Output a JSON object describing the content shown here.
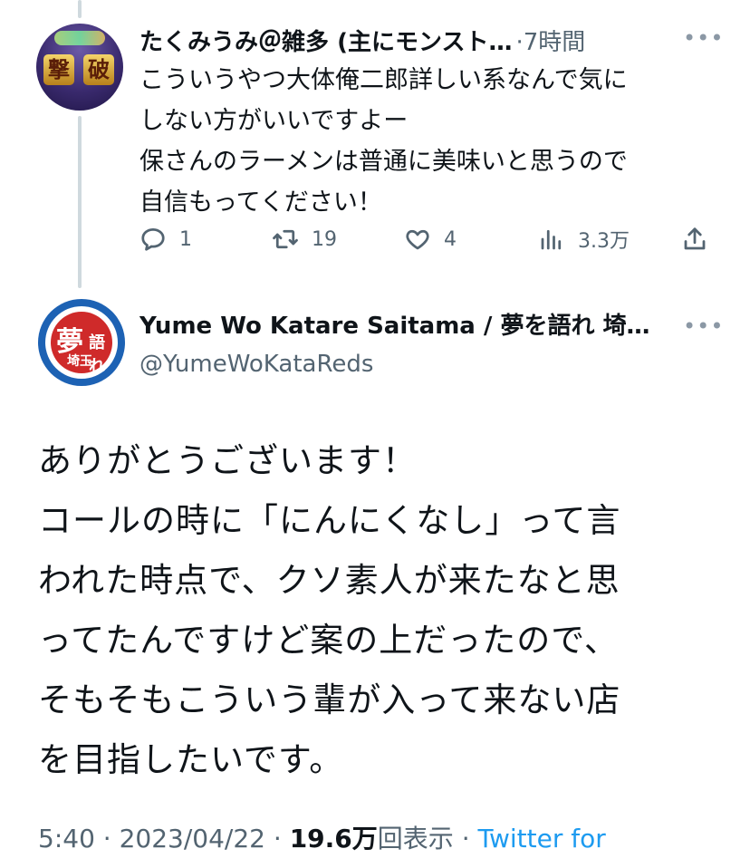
{
  "reply": {
    "author_name": "たくみうみ＠雑多 (主にモンスト…",
    "time": "·7時間",
    "lines": [
      "こういうやつ大体俺二郎詳しい系なんで気に",
      "しない方がいいですよー",
      "保さんのラーメンは普通に美味いと思うので",
      "自信もってください！"
    ],
    "stats": {
      "replies": "1",
      "retweets": "19",
      "likes": "4",
      "views": "3.3万"
    },
    "avatar_chars": [
      "撃",
      "破"
    ]
  },
  "main_tweet": {
    "author_name": "Yume Wo Katare Saitama / 夢を語れ 埼…",
    "handle": "@YumeWoKataReds",
    "avatar_chars": [
      "夢",
      "語れ",
      "埼玉"
    ],
    "lines": [
      "ありがとうございます！",
      "コールの時に「にんにくなし」って言",
      "われた時点で、クソ素人が来たなと思",
      "ってたんですけど案の上だったので、",
      "そもそもこういう輩が入って来ない店",
      "を目指したいです。"
    ],
    "meta": {
      "time": "5:40",
      "sep1": " · ",
      "date": "2023/04/22",
      "sep2": " · ",
      "views_num": "19.6万",
      "views_label": "回表示",
      "sep3": " · ",
      "source": "Twitter for"
    }
  },
  "icons": {
    "more": "more-icon",
    "reply": "reply-icon",
    "retweet": "retweet-icon",
    "like": "like-icon",
    "views": "views-icon",
    "share": "share-icon"
  },
  "colors": {
    "text": "#0f1419",
    "secondary": "#536471",
    "link": "#1d9bf0",
    "thread_line": "#cfd9de"
  }
}
